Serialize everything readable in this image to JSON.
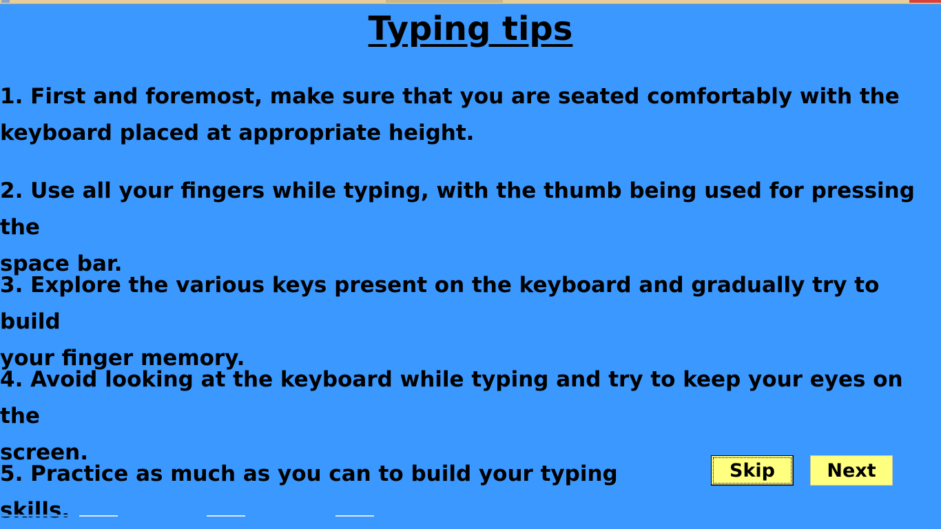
{
  "page": {
    "title": "Typing tips"
  },
  "tips": [
    "1. First and foremost, make sure that you are seated comfortably with the\nkeyboard placed at appropriate height.",
    "2. Use all your fingers while typing, with the thumb being used for pressing the\nspace bar.",
    "3. Explore the various keys present on the keyboard and gradually try to build\nyour finger memory.",
    "4. Avoid looking at the keyboard while typing and try to keep your eyes on the\nscreen.",
    "5. Practice as much as you can to build your typing skills."
  ],
  "buttons": {
    "skip": "Skip",
    "next": "Next"
  },
  "colors": {
    "background": "#3a98ff",
    "button": "#ffff80",
    "text": "#000000"
  }
}
